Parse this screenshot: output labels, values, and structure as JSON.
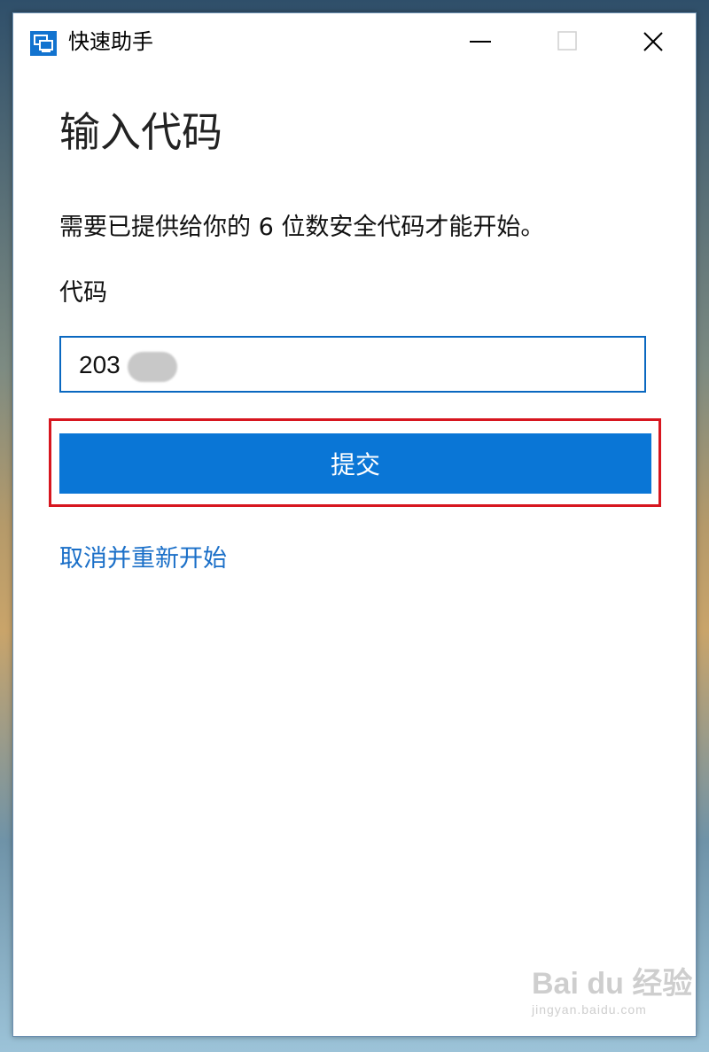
{
  "window": {
    "title": "快速助手"
  },
  "form": {
    "heading": "输入代码",
    "description": "需要已提供给你的 6 位数安全代码才能开始。",
    "code_label": "代码",
    "code_value": "203",
    "submit_label": "提交",
    "cancel_label": "取消并重新开始"
  },
  "watermark": {
    "main": "Bai du 经验",
    "url": "jingyan.baidu.com"
  },
  "colors": {
    "accent": "#0a76d6",
    "highlight_border": "#d7161f",
    "link": "#1a6fc8"
  },
  "icons": [
    "quick-assist-icon",
    "minimize-icon",
    "maximize-icon",
    "close-icon"
  ]
}
